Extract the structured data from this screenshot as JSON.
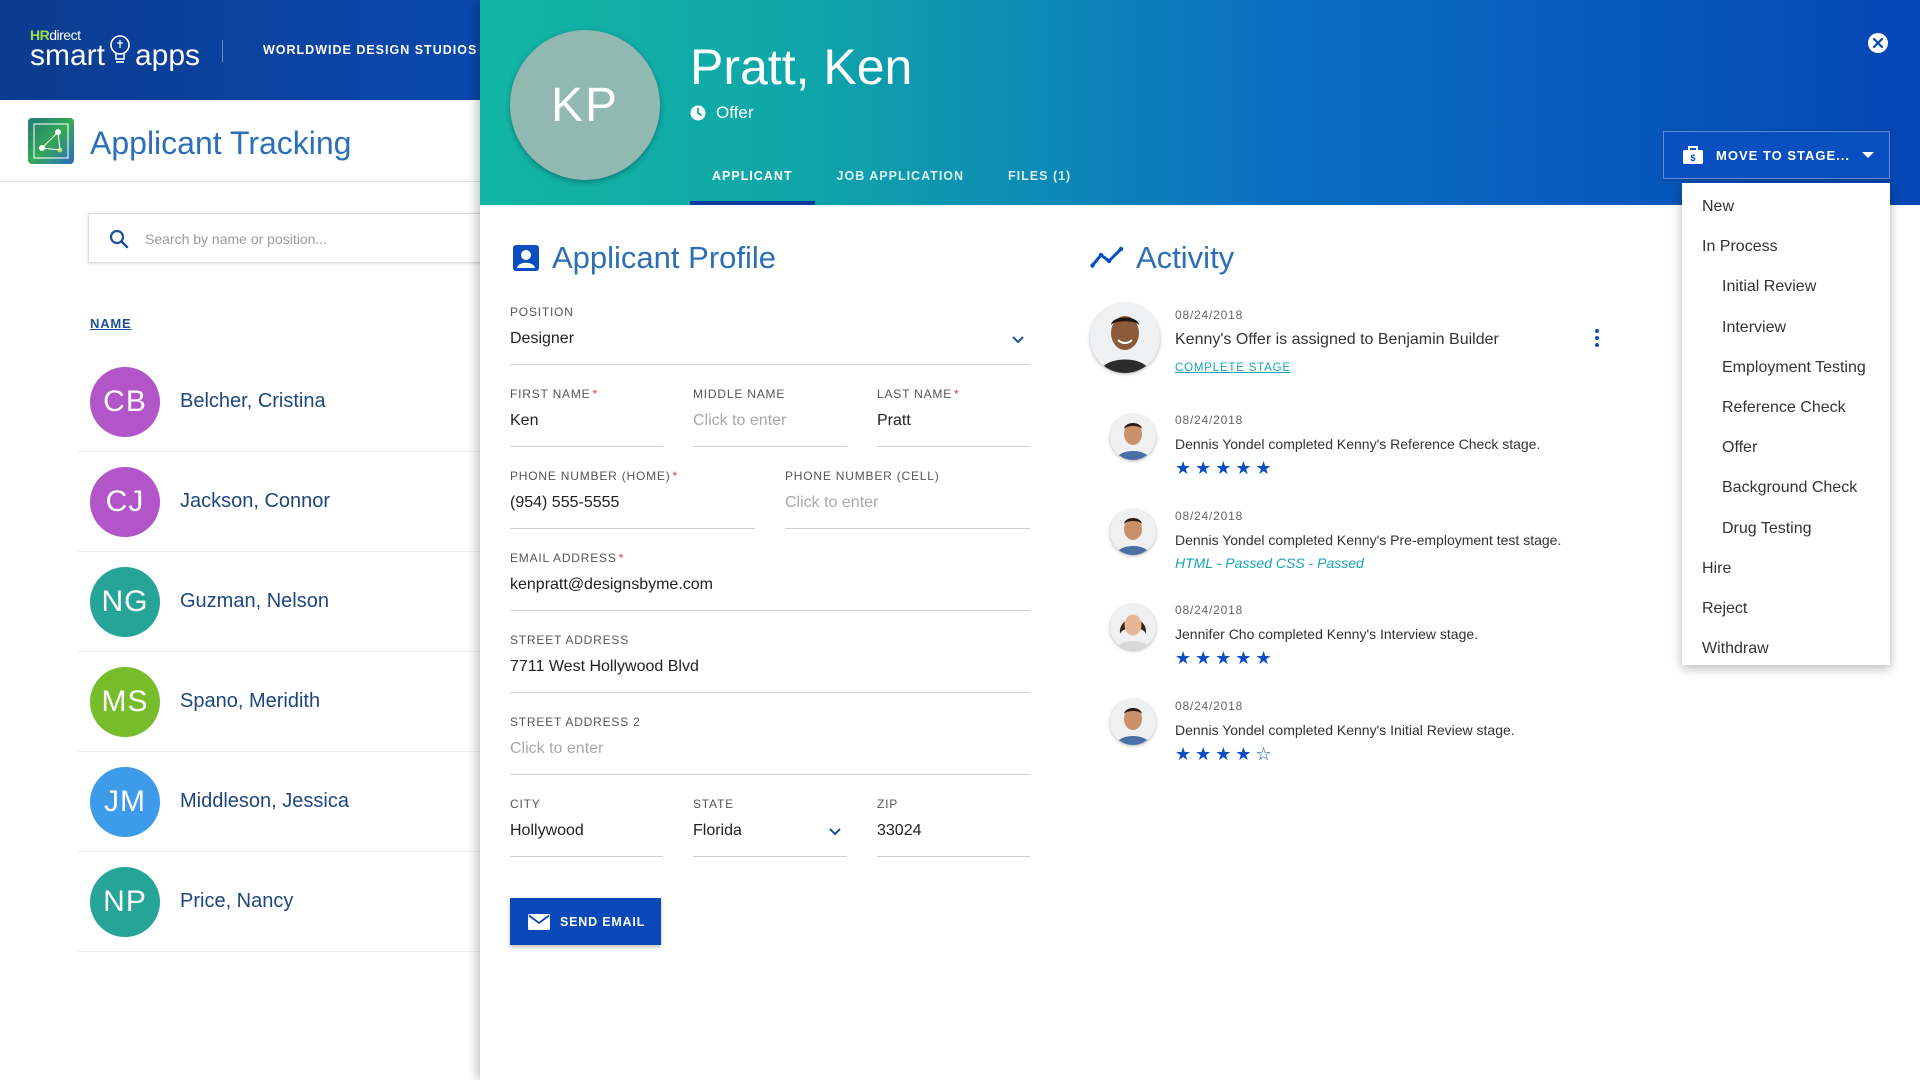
{
  "brand": {
    "hr_prefix": "HR",
    "hr_suffix": "direct",
    "smart": "smart",
    "apps": "apps",
    "org_name": "WORLDWIDE DESIGN STUDIOS"
  },
  "app": {
    "title": "Applicant Tracking",
    "search_placeholder": "Search by name or position...",
    "column_header": "NAME"
  },
  "applicants": [
    {
      "initials": "CB",
      "name": "Belcher, Cristina",
      "color": "#b255c8"
    },
    {
      "initials": "CJ",
      "name": "Jackson, Connor",
      "color": "#b255c8"
    },
    {
      "initials": "NG",
      "name": "Guzman, Nelson",
      "color": "#26a497"
    },
    {
      "initials": "MS",
      "name": "Spano, Meridith",
      "color": "#77bc2a"
    },
    {
      "initials": "JM",
      "name": "Middleson, Jessica",
      "color": "#3d9be9"
    },
    {
      "initials": "NP",
      "name": "Price, Nancy",
      "color": "#26a497"
    }
  ],
  "detail": {
    "initials": "KP",
    "name": "Pratt, Ken",
    "status": "Offer",
    "tabs": [
      "APPLICANT",
      "JOB APPLICATION",
      "FILES (1)"
    ],
    "active_tab": "APPLICANT",
    "move_stage_label": "MOVE TO STAGE...",
    "stages": [
      {
        "label": "New",
        "level": 0
      },
      {
        "label": "In Process",
        "level": 0
      },
      {
        "label": "Initial Review",
        "level": 1
      },
      {
        "label": "Interview",
        "level": 1
      },
      {
        "label": "Employment Testing",
        "level": 1
      },
      {
        "label": "Reference Check",
        "level": 1
      },
      {
        "label": "Offer",
        "level": 1
      },
      {
        "label": "Background Check",
        "level": 1
      },
      {
        "label": "Drug Testing",
        "level": 1
      },
      {
        "label": "Hire",
        "level": 0
      },
      {
        "label": "Reject",
        "level": 0
      },
      {
        "label": "Withdraw",
        "level": 0
      }
    ]
  },
  "profile": {
    "title": "Applicant Profile",
    "position": {
      "label": "POSITION",
      "value": "Designer"
    },
    "first_name": {
      "label": "FIRST NAME",
      "value": "Ken"
    },
    "middle_name": {
      "label": "MIDDLE NAME",
      "placeholder": "Click to enter"
    },
    "last_name": {
      "label": "LAST NAME",
      "value": "Pratt"
    },
    "phone_home": {
      "label": "PHONE NUMBER (HOME)",
      "value": "(954) 555-5555"
    },
    "phone_cell": {
      "label": "PHONE NUMBER (CELL)",
      "placeholder": "Click to enter"
    },
    "email": {
      "label": "EMAIL ADDRESS",
      "value": "kenpratt@designsbyme.com"
    },
    "street": {
      "label": "STREET ADDRESS",
      "value": "7711 West Hollywood Blvd"
    },
    "street2": {
      "label": "STREET ADDRESS 2",
      "placeholder": "Click to enter"
    },
    "city": {
      "label": "CITY",
      "value": "Hollywood"
    },
    "state": {
      "label": "STATE",
      "value": "Florida"
    },
    "zip": {
      "label": "ZIP",
      "value": "33024"
    },
    "send_email_label": "SEND EMAIL"
  },
  "activity": {
    "title": "Activity",
    "items": [
      {
        "date": "08/24/2018",
        "text": "Kenny's Offer is assigned to Benjamin Builder",
        "link": "COMPLETE STAGE"
      },
      {
        "date": "08/24/2018",
        "text": "Dennis Yondel completed Kenny's Reference Check stage.",
        "stars": "★★★★★"
      },
      {
        "date": "08/24/2018",
        "text": "Dennis Yondel completed Kenny's Pre-employment test stage.",
        "sub": "HTML - Passed CSS - Passed"
      },
      {
        "date": "08/24/2018",
        "text": "Jennifer Cho completed Kenny's Interview stage.",
        "stars": "★★★★★"
      },
      {
        "date": "08/24/2018",
        "text": "Dennis Yondel completed Kenny's Initial Review stage.",
        "stars": "★★★★☆"
      }
    ]
  },
  "colors": {
    "brand_blue": "#0a49b9",
    "accent_teal": "#17a2b8",
    "title_blue": "#2c6fb8"
  }
}
